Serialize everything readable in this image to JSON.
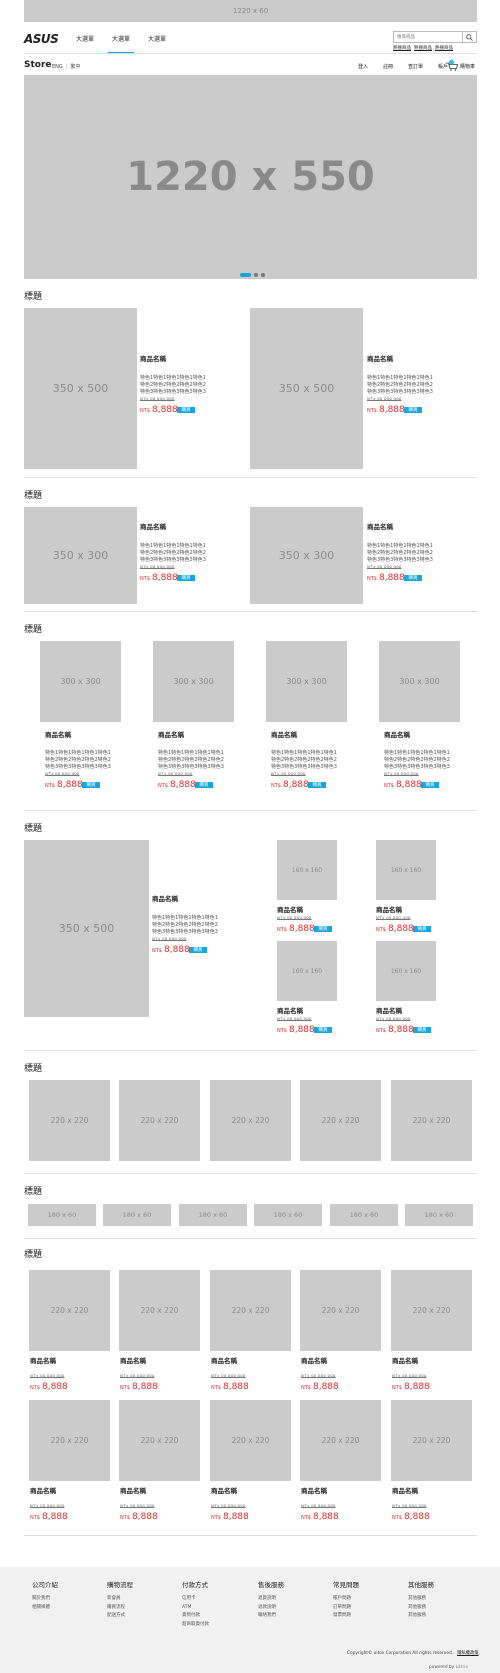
{
  "top_banner": "1220 x 60",
  "header": {
    "logo": "ASUS",
    "nav": [
      "大選單",
      "大選單",
      "大選單"
    ],
    "search_placeholder": "搜尋商品",
    "hot_links": [
      "熱搜商品",
      "熱搜商品",
      "熱搜商品"
    ]
  },
  "subheader": {
    "store": "Store",
    "lang_en": "ENG",
    "lang_zh": "繁中",
    "menu": [
      "登入",
      "註冊",
      "查訂單",
      "帳戶"
    ],
    "cart_label": "購物車",
    "cart_count": "0"
  },
  "hero": {
    "label": "1220 x 550"
  },
  "common": {
    "product_name": "商品名稱",
    "desc_lines": [
      "特色1特色1特色1特色1特色1",
      "特色2特色2特色2特色2特色2",
      "特色3特色3特色3特色3特色3"
    ],
    "old_price": "NT$ 88,888,888",
    "currency": "NT$",
    "price": "8,888",
    "buy": "購買"
  },
  "sections": [
    {
      "title": "標題",
      "img": "350 x 500"
    },
    {
      "title": "標題",
      "img": "350 x 300"
    },
    {
      "title": "標題",
      "img": "300 x 300"
    },
    {
      "title": "標題",
      "img_big": "350 x 500",
      "img_small": "160 x 160"
    },
    {
      "title": "標題",
      "img": "220 x 220"
    },
    {
      "title": "標題",
      "img": "180 x 60"
    },
    {
      "title": "標題",
      "img": "220 x 220"
    }
  ],
  "footer": {
    "columns": [
      {
        "title": "公司介紹",
        "links": [
          "關於我們",
          "相關媒體"
        ]
      },
      {
        "title": "購物流程",
        "links": [
          "新會員",
          "購買流程",
          "配送方式"
        ]
      },
      {
        "title": "付款方式",
        "links": [
          "信用卡",
          "ATM",
          "貨到付款",
          "超商取貨付款"
        ]
      },
      {
        "title": "售後服務",
        "links": [
          "退貨說明",
          "退款說明",
          "聯絡我們"
        ]
      },
      {
        "title": "常見問題",
        "links": [
          "帳戶問題",
          "訂單問題",
          "發票問題"
        ]
      },
      {
        "title": "其他服務",
        "links": [
          "其他服務",
          "其他服務",
          "其他服務"
        ]
      }
    ],
    "copyright": "Copyright© uitox Corporation All rights reserved.",
    "privacy": "隱私權政策",
    "powered_by": "powered by",
    "powered_brand": "uitox"
  },
  "colors": {
    "accent": "#15a6e0",
    "price": "#e52b2b",
    "placeholder": "#cbcbcb"
  }
}
